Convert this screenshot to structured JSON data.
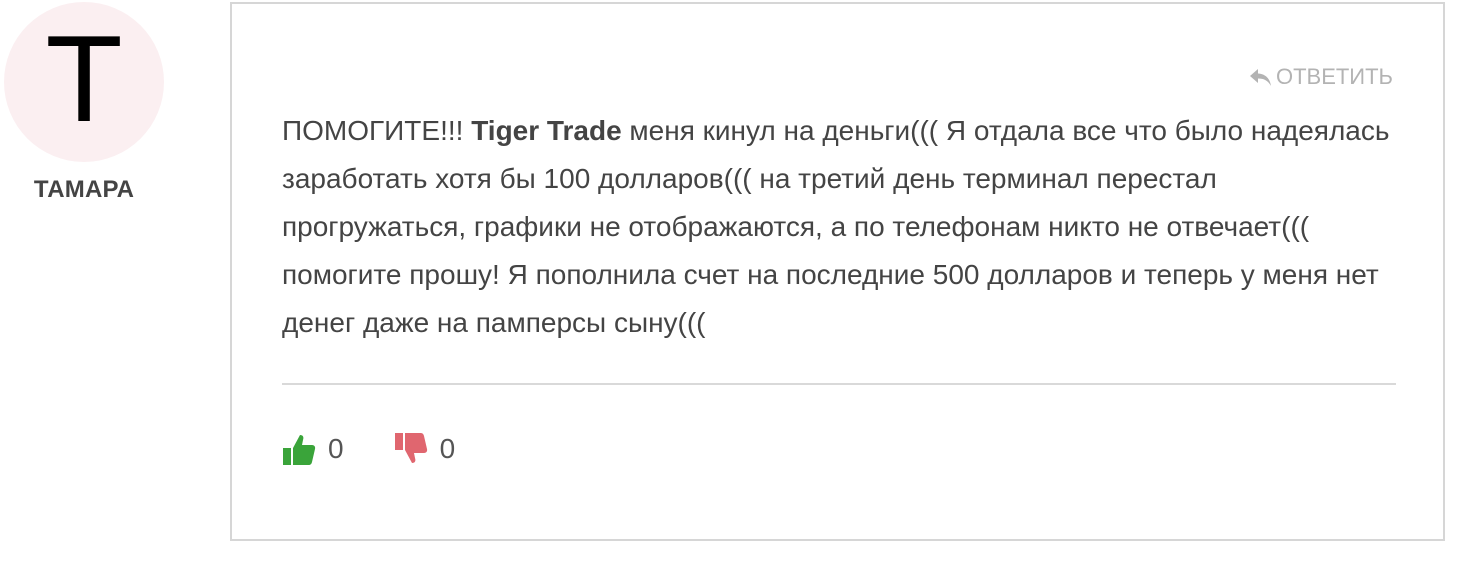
{
  "author": {
    "initial": "Т",
    "name": "ТАМАРА",
    "avatar_bg": "#fbeff1"
  },
  "comment": {
    "reply_label": "ОТВЕТИТЬ",
    "reply_icon": "reply-arrow-icon",
    "text_before": "ПОМОГИТЕ!!! ",
    "brand": "Tiger Trade",
    "text_after": " меня кинул на деньги((( Я отдала все что было надеялась заработать хотя бы 100 долларов((( на третий день терминал перестал прогружаться, графики не отображаются, а по телефонам никто не отвечает((( помогите прошу! Я пополнила счет на последние 500 долларов и теперь у меня нет денег даже на памперсы сыну((("
  },
  "votes": {
    "like": {
      "icon": "thumbs-up-icon",
      "count": "0",
      "color": "#3aa43a"
    },
    "dislike": {
      "icon": "thumbs-down-icon",
      "count": "0",
      "color": "#e0666f"
    }
  }
}
